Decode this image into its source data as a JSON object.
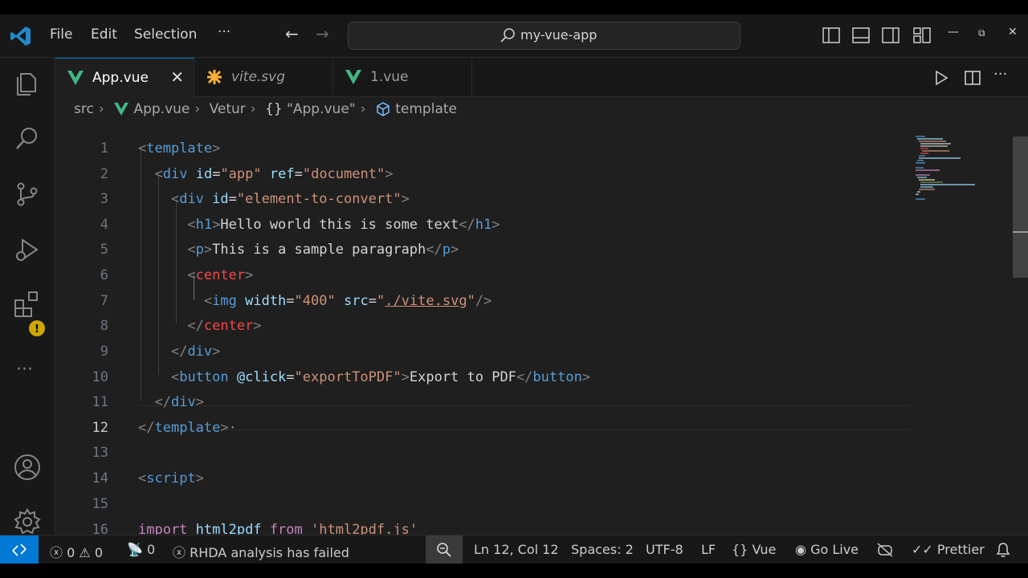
{
  "menu": {
    "file": "File",
    "edit": "Edit",
    "selection": "Selection",
    "more": "···"
  },
  "command_center": {
    "label": "my-vue-app"
  },
  "tabs": [
    {
      "name": "App.vue",
      "icon": "vue-icon",
      "active": true,
      "close": "✕"
    },
    {
      "name": "vite.svg",
      "icon": "svg-file-icon",
      "active": false
    },
    {
      "name": "1.vue",
      "icon": "vue-icon",
      "active": false
    }
  ],
  "breadcrumb": {
    "items": [
      "src",
      "App.vue",
      "Vetur",
      "\"App.vue\"",
      "template"
    ],
    "braces": "{}"
  },
  "editor": {
    "current_line": 12,
    "line_numbers": [
      "1",
      "2",
      "3",
      "4",
      "5",
      "6",
      "7",
      "8",
      "9",
      "10",
      "11",
      "12",
      "13",
      "14",
      "15",
      "16"
    ]
  },
  "status": {
    "errors": "0",
    "warnings": "0",
    "ports": "0",
    "rhda": "RHDA analysis has failed",
    "position": "Ln 12, Col 12",
    "spaces": "Spaces: 2",
    "encoding": "UTF-8",
    "eol": "LF",
    "language": "Vue",
    "go_live": "Go Live",
    "prettier": "Prettier"
  },
  "colors": {
    "accent": "#0078d4",
    "vue_green": "#41b883",
    "svg_orange": "#ffb13b"
  }
}
